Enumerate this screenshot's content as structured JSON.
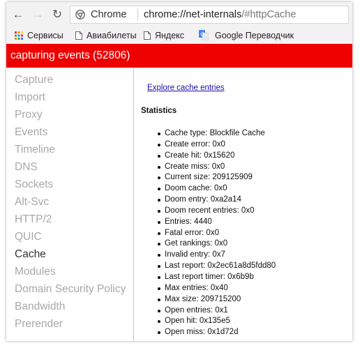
{
  "toolbar": {
    "back_icon": "←",
    "forward_icon": "→",
    "reload_icon": "↻",
    "site_chip": "Chrome",
    "url_host": "chrome://net-internals",
    "url_path": "/#httpCache"
  },
  "bookmarks": [
    {
      "label": "Сервисы",
      "icon": "apps-grid-icon"
    },
    {
      "label": "Авиабилеты",
      "icon": "document-icon"
    },
    {
      "label": "Яндекс",
      "icon": "document-icon"
    },
    {
      "label": "Google Переводчик",
      "icon": "google-translate-icon"
    }
  ],
  "banner": {
    "text": "capturing events (52806)",
    "color": "#ee0000"
  },
  "tabs": [
    {
      "label": "Capture"
    },
    {
      "label": "Import"
    },
    {
      "label": "Proxy"
    },
    {
      "label": "Events"
    },
    {
      "label": "Timeline"
    },
    {
      "label": "DNS"
    },
    {
      "label": "Sockets"
    },
    {
      "label": "Alt-Svc"
    },
    {
      "label": "HTTP/2"
    },
    {
      "label": "QUIC"
    },
    {
      "label": "Cache"
    },
    {
      "label": "Modules"
    },
    {
      "label": "Domain Security Policy"
    },
    {
      "label": "Bandwidth"
    },
    {
      "label": "Prerender"
    }
  ],
  "active_tab": "Cache",
  "main": {
    "explore_link": "Explore cache entries",
    "stats_title": "Statistics",
    "stats": [
      "Cache type: Blockfile Cache",
      "Create error: 0x0",
      "Create hit: 0x15620",
      "Create miss: 0x0",
      "Current size: 209125909",
      "Doom cache: 0x0",
      "Doom entry: 0xa2a14",
      "Doom recent entries: 0x0",
      "Entries: 4440",
      "Fatal error: 0x0",
      "Get rankings: 0x0",
      "Invalid entry: 0x7",
      "Last report: 0x2ec61a8d5fdd80",
      "Last report timer: 0x6b9b",
      "Max entries: 0x40",
      "Max size: 209715200",
      "Open entries: 0x1",
      "Open hit: 0x135e5",
      "Open miss: 0x1d72d"
    ]
  }
}
